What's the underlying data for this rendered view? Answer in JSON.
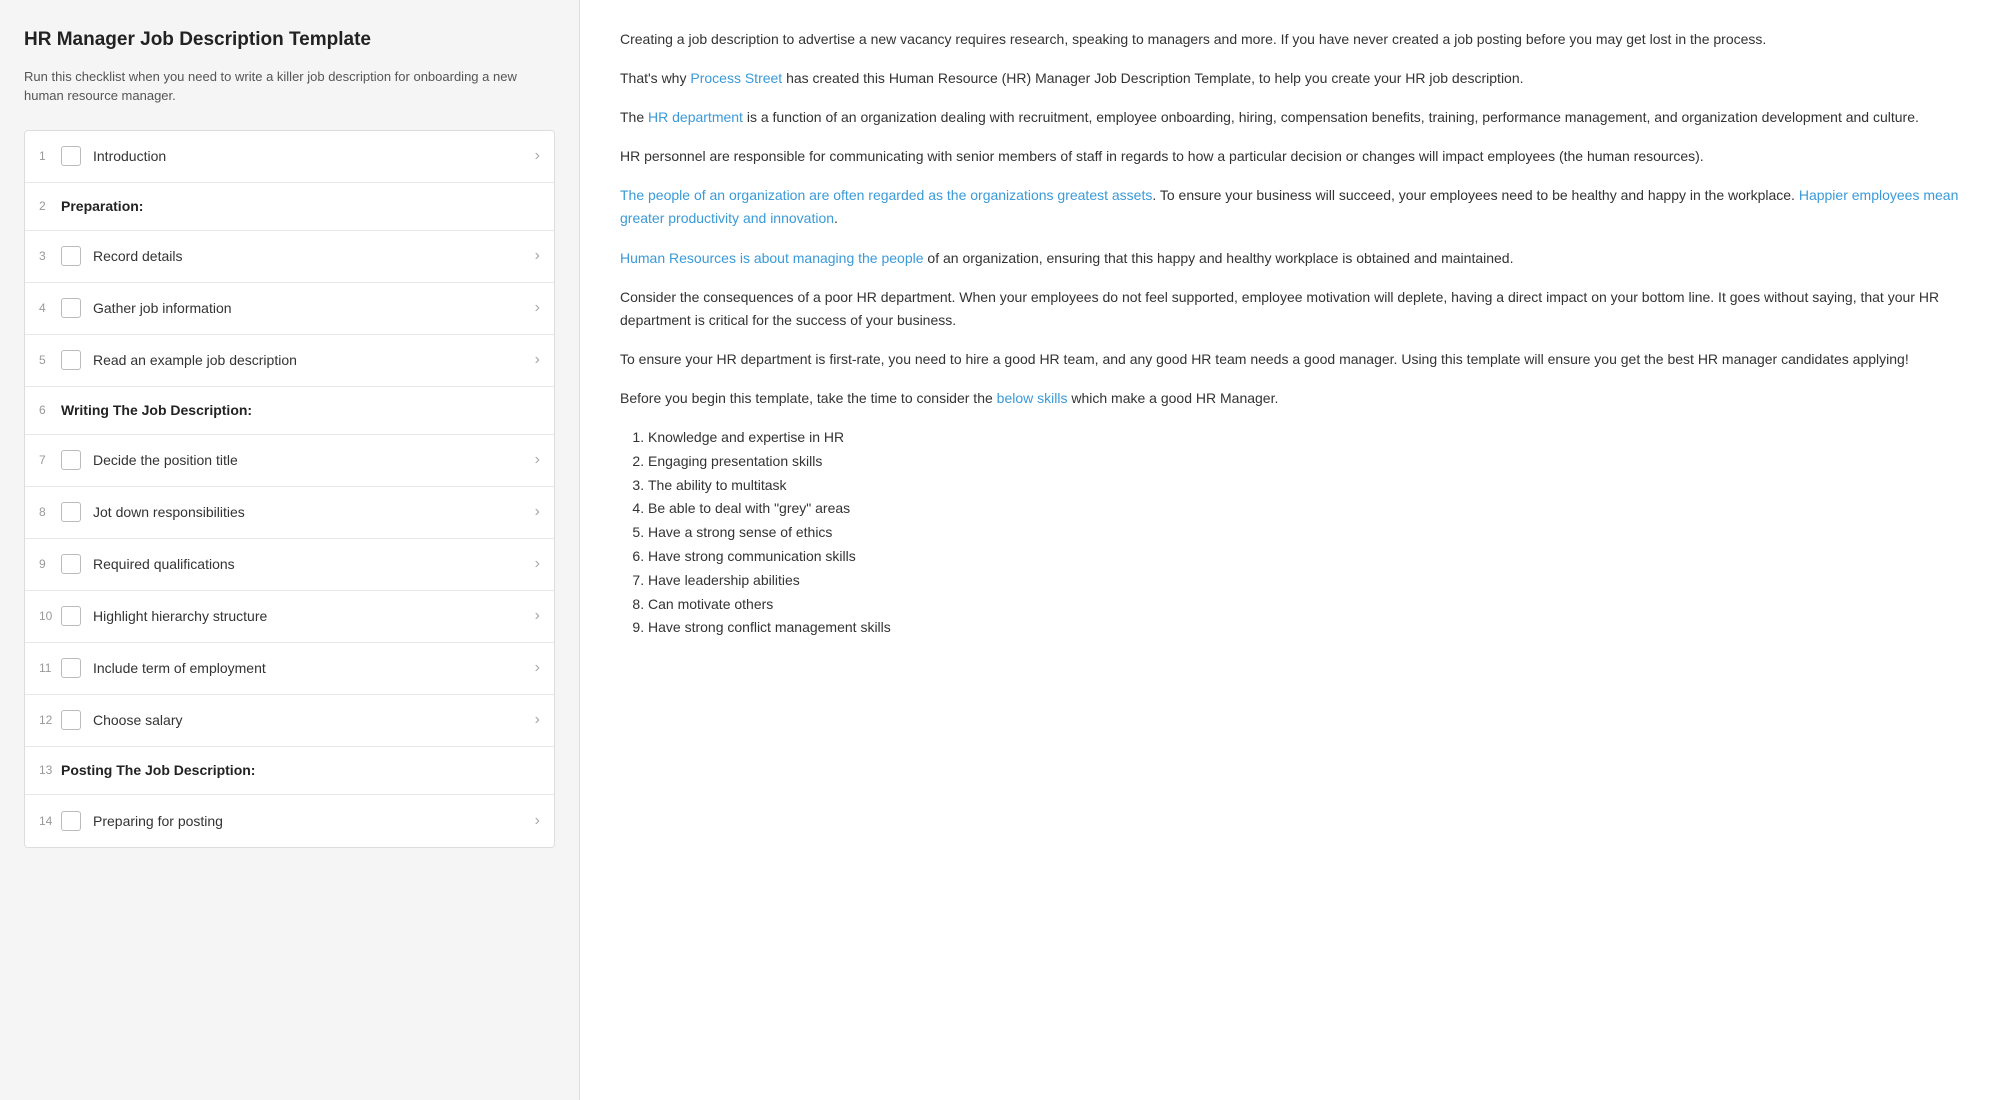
{
  "left": {
    "title": "HR Manager Job Description Template",
    "subtitle": "Run this checklist when you need to write a killer job description for onboarding a new human resource manager.",
    "items": [
      {
        "num": "1",
        "type": "task",
        "label": "Introduction"
      },
      {
        "num": "2",
        "type": "section",
        "label": "Preparation:"
      },
      {
        "num": "3",
        "type": "task",
        "label": "Record details"
      },
      {
        "num": "4",
        "type": "task",
        "label": "Gather job information"
      },
      {
        "num": "5",
        "type": "task",
        "label": "Read an example job description"
      },
      {
        "num": "6",
        "type": "section",
        "label": "Writing The Job Description:"
      },
      {
        "num": "7",
        "type": "task",
        "label": "Decide the position title"
      },
      {
        "num": "8",
        "type": "task",
        "label": "Jot down responsibilities"
      },
      {
        "num": "9",
        "type": "task",
        "label": "Required qualifications"
      },
      {
        "num": "10",
        "type": "task",
        "label": "Highlight hierarchy structure"
      },
      {
        "num": "11",
        "type": "task",
        "label": "Include term of employment"
      },
      {
        "num": "12",
        "type": "task",
        "label": "Choose salary"
      },
      {
        "num": "13",
        "type": "section",
        "label": "Posting The Job Description:"
      },
      {
        "num": "14",
        "type": "task",
        "label": "Preparing for posting"
      }
    ]
  },
  "right": {
    "paragraphs": [
      "Creating a job description to advertise a new vacancy requires research, speaking to managers and more. If you have never created a job posting before you may get lost in the process.",
      "That's why {Process Street} has created this Human Resource (HR) Manager Job Description Template, to help you create your HR job description.",
      "The {HR department} is a function of an organization dealing with recruitment, employee onboarding, hiring, compensation benefits, training, performance management, and organization development and culture.",
      "HR personnel are responsible for communicating with senior members of staff in regards to how a particular decision or changes will impact employees (the human resources).",
      "{The people of an organization are often regarded as the organizations greatest assets}. To ensure your business will succeed, your employees need to be healthy and happy in the workplace. {Happier employees mean greater productivity and innovation}.",
      "{Human Resources is about managing the people} of an organization, ensuring that this happy and healthy workplace is obtained and maintained.",
      "Consider the consequences of a poor HR department. When your employees do not feel supported, employee motivation will deplete, having a direct impact on your bottom line. It goes without saying, that your HR department is critical for the success of your business.",
      "To ensure your HR department is first-rate, you need to hire a good HR team, and any good HR team needs a good manager. Using this template will ensure you get the best HR manager candidates applying!",
      "Before you begin this template, take the time to consider the {below skills} which make a good HR Manager."
    ],
    "list_items": [
      "Knowledge and expertise in HR",
      "Engaging presentation skills",
      "The ability to multitask",
      "Be able to deal with \"grey\" areas",
      "Have a strong sense of ethics",
      "Have strong communication skills",
      "Have leadership abilities",
      "Can motivate others",
      "Have strong conflict management skills"
    ]
  }
}
